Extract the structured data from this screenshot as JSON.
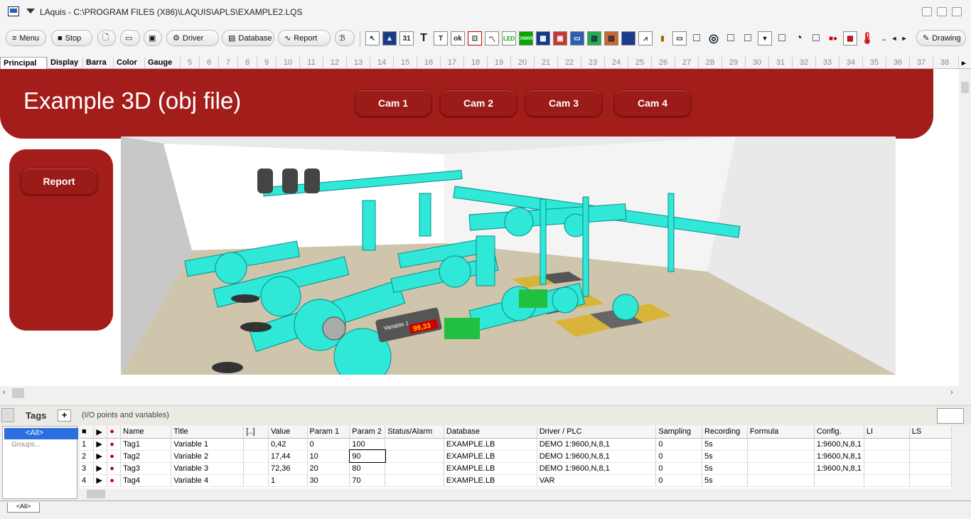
{
  "window": {
    "title": "LAquis - C:\\PROGRAM FILES (X86)\\LAQUIS\\APLS\\EXAMPLE2.LQS"
  },
  "toolbar": {
    "menu": "Menu",
    "stop": "Stop",
    "driver": "Driver",
    "database": "Database",
    "report": "Report",
    "drawing": "Drawing"
  },
  "tabs": [
    "Principal",
    "Display",
    "Barra",
    "Color",
    "Gauge",
    "5",
    "6",
    "7",
    "8",
    "9",
    "10",
    "11",
    "12",
    "13",
    "14",
    "15",
    "16",
    "17",
    "18",
    "19",
    "20",
    "21",
    "22",
    "23",
    "24",
    "25",
    "26",
    "27",
    "28",
    "29",
    "30",
    "31",
    "32",
    "33",
    "34",
    "35",
    "36",
    "37",
    "38"
  ],
  "banner": {
    "title": "Example 3D (obj file)",
    "cams": [
      "Cam 1",
      "Cam 2",
      "Cam 3",
      "Cam 4"
    ]
  },
  "side": {
    "report": "Report"
  },
  "scene": {
    "gauge_label": "Variable 1",
    "gauge_value": "99,33"
  },
  "tags": {
    "label": "Tags",
    "add": "+",
    "description": "(I/O points and variables)",
    "tree_all": "<All>",
    "tree_groups": "Groups..."
  },
  "grid": {
    "headers": [
      "Name",
      "Title",
      "[..]",
      "Value",
      "Param 1",
      "Param 2",
      "Status/Alarm",
      "Database",
      "Driver / PLC",
      "Sampling",
      "Recording",
      "Formula",
      "Config.",
      "LI",
      "LS"
    ],
    "rows": [
      [
        "1",
        "Tag1",
        "Variable 1",
        "",
        "0,42",
        "0",
        "100",
        "",
        "EXAMPLE.LB",
        "DEMO 1:9600,N,8,1",
        "0",
        "5s",
        "",
        "1:9600,N,8,1",
        "",
        ""
      ],
      [
        "2",
        "Tag2",
        "Variable 2",
        "",
        "17,44",
        "10",
        "90",
        "",
        "EXAMPLE.LB",
        "DEMO 1:9600,N,8,1",
        "0",
        "5s",
        "",
        "1:9600,N,8,1",
        "",
        ""
      ],
      [
        "3",
        "Tag3",
        "Variable 3",
        "",
        "72,36",
        "20",
        "80",
        "",
        "EXAMPLE.LB",
        "DEMO 1:9600,N,8,1",
        "0",
        "5s",
        "",
        "1:9600,N,8,1",
        "",
        ""
      ],
      [
        "4",
        "Tag4",
        "Variable 4",
        "",
        "1",
        "30",
        "70",
        "",
        "EXAMPLE.LB",
        "VAR",
        "0",
        "5s",
        "",
        "",
        "",
        ""
      ]
    ]
  },
  "bottom": {
    "tab": "<All>"
  }
}
